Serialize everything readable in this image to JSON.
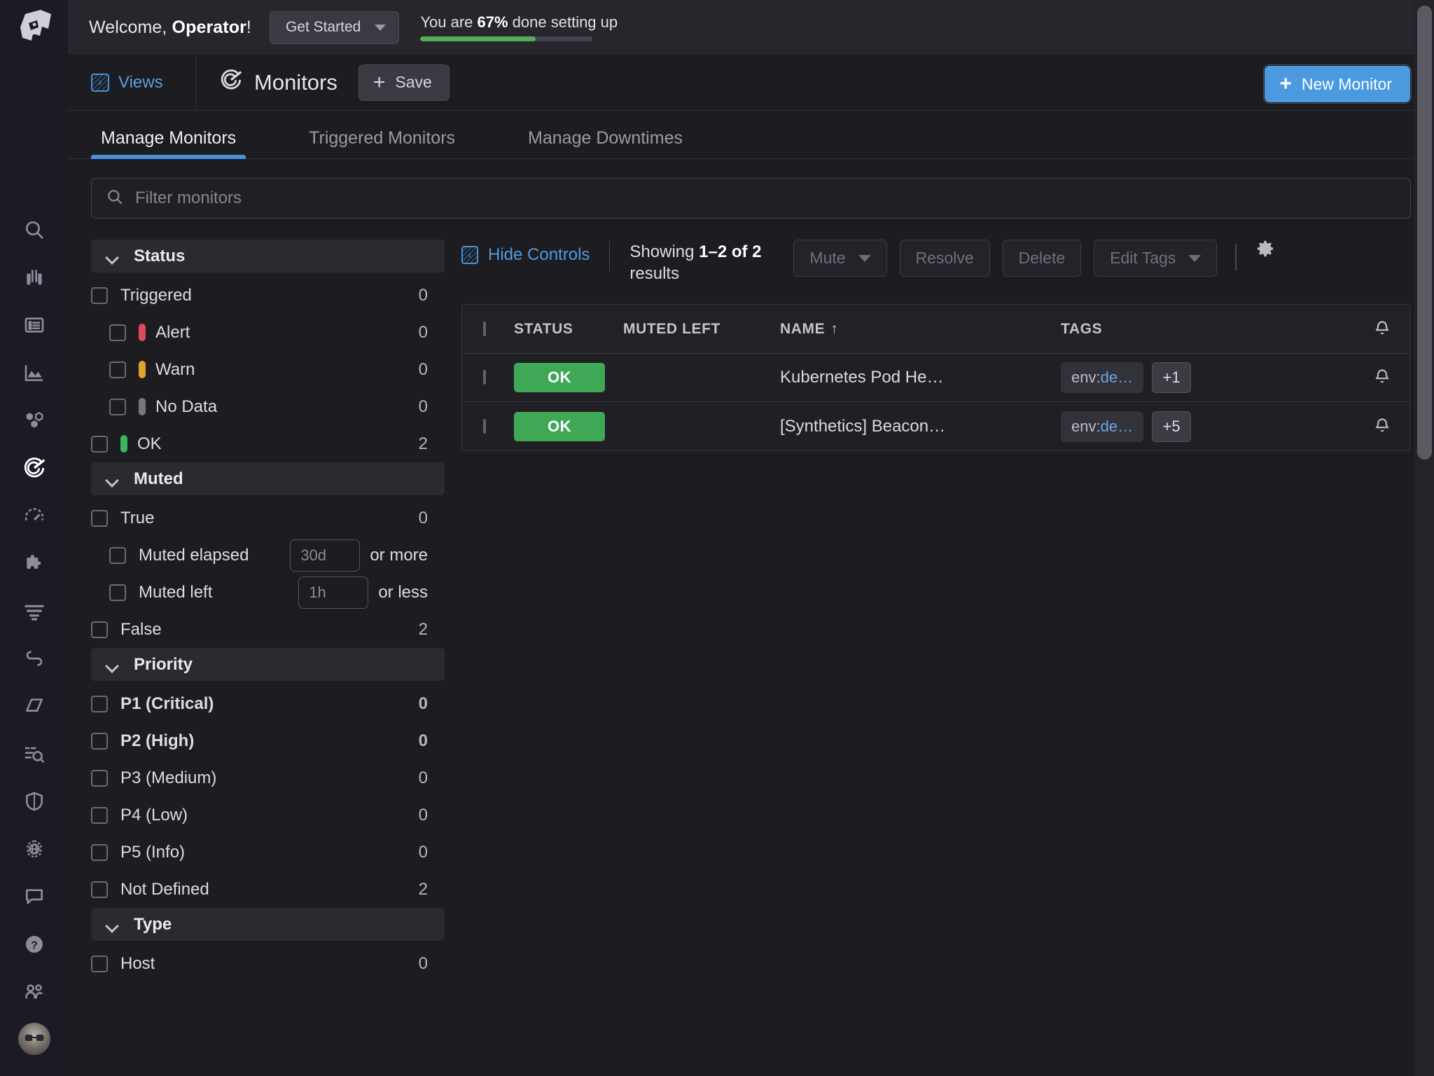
{
  "welcome": {
    "greeting_prefix": "Welcome, ",
    "user": "Operator",
    "greeting_suffix": "!",
    "get_started_label": "Get Started",
    "setup_prefix": "You are ",
    "setup_percent": "67%",
    "setup_suffix": " done setting up",
    "progress_value": 67,
    "progress_color": "#57ad57"
  },
  "header": {
    "views_label": "Views",
    "title": "Monitors",
    "save_label": "Save",
    "new_monitor_label": "New Monitor",
    "accent_color": "#4b9ae0"
  },
  "tabs": [
    {
      "label": "Manage Monitors",
      "active": true
    },
    {
      "label": "Triggered Monitors",
      "active": false
    },
    {
      "label": "Manage Downtimes",
      "active": false
    }
  ],
  "filter": {
    "placeholder": "Filter monitors"
  },
  "facets": [
    {
      "title": "Status",
      "rows": [
        {
          "label": "Triggered",
          "count": "0",
          "indent": false,
          "pill": null,
          "bold": false
        },
        {
          "label": "Alert",
          "count": "0",
          "indent": true,
          "pill": "alert",
          "bold": false
        },
        {
          "label": "Warn",
          "count": "0",
          "indent": true,
          "pill": "warn",
          "bold": false
        },
        {
          "label": "No Data",
          "count": "0",
          "indent": true,
          "pill": "nodata",
          "bold": false
        },
        {
          "label": "OK",
          "count": "2",
          "indent": false,
          "pill": "ok",
          "bold": false
        }
      ]
    },
    {
      "title": "Muted",
      "rows": [
        {
          "label": "True",
          "count": "0",
          "indent": false,
          "pill": null,
          "bold": false
        },
        {
          "label": "Muted elapsed",
          "count": "",
          "indent": true,
          "pill": null,
          "bold": false,
          "input_value": "30d",
          "suffix": "or more"
        },
        {
          "label": "Muted left",
          "count": "",
          "indent": true,
          "pill": null,
          "bold": false,
          "input_value": "1h",
          "suffix": "or less"
        },
        {
          "label": "False",
          "count": "2",
          "indent": false,
          "pill": null,
          "bold": false
        }
      ]
    },
    {
      "title": "Priority",
      "rows": [
        {
          "label": "P1 (Critical)",
          "count": "0",
          "indent": false,
          "pill": null,
          "bold": true
        },
        {
          "label": "P2 (High)",
          "count": "0",
          "indent": false,
          "pill": null,
          "bold": true
        },
        {
          "label": "P3 (Medium)",
          "count": "0",
          "indent": false,
          "pill": null,
          "bold": false
        },
        {
          "label": "P4 (Low)",
          "count": "0",
          "indent": false,
          "pill": null,
          "bold": false
        },
        {
          "label": "P5 (Info)",
          "count": "0",
          "indent": false,
          "pill": null,
          "bold": false
        },
        {
          "label": "Not Defined",
          "count": "2",
          "indent": false,
          "pill": null,
          "bold": false
        }
      ]
    },
    {
      "title": "Type",
      "rows": [
        {
          "label": "Host",
          "count": "0",
          "indent": false,
          "pill": null,
          "bold": false
        }
      ]
    }
  ],
  "controls": {
    "hide_controls_label": "Hide Controls",
    "showing_prefix": "Showing ",
    "showing_range": "1–2 of 2",
    "showing_suffix": " results",
    "buttons": [
      {
        "label": "Mute",
        "has_caret": true
      },
      {
        "label": "Resolve",
        "has_caret": false
      },
      {
        "label": "Delete",
        "has_caret": false
      },
      {
        "label": "Edit Tags",
        "has_caret": true
      }
    ]
  },
  "table": {
    "columns": {
      "status": "STATUS",
      "muted_left": "MUTED LEFT",
      "name": "NAME",
      "name_sort": "↑",
      "tags": "TAGS"
    },
    "rows": [
      {
        "status": "OK",
        "status_color": "#3fa856",
        "muted_left": "",
        "name": "Kubernetes Pod He…",
        "tag_key": "env:",
        "tag_value": "de…",
        "tag_more": "+1"
      },
      {
        "status": "OK",
        "status_color": "#3fa856",
        "muted_left": "",
        "name": "[Synthetics] Beacon…",
        "tag_key": "env:",
        "tag_value": "de…",
        "tag_more": "+5"
      }
    ]
  },
  "rail": {
    "items": [
      {
        "name": "search-icon"
      },
      {
        "name": "binoculars-icon"
      },
      {
        "name": "list-icon"
      },
      {
        "name": "area-chart-icon"
      },
      {
        "name": "hexagons-icon"
      },
      {
        "name": "monitors-icon"
      },
      {
        "name": "gauge-icon"
      },
      {
        "name": "puzzle-icon"
      },
      {
        "name": "logs-icon"
      },
      {
        "name": "apm-trace-icon"
      },
      {
        "name": "notebook-icon"
      },
      {
        "name": "log-search-icon"
      },
      {
        "name": "security-shield-icon"
      },
      {
        "name": "network-globe-icon"
      },
      {
        "name": "chat-icon"
      },
      {
        "name": "help-icon"
      },
      {
        "name": "team-icon"
      }
    ]
  }
}
